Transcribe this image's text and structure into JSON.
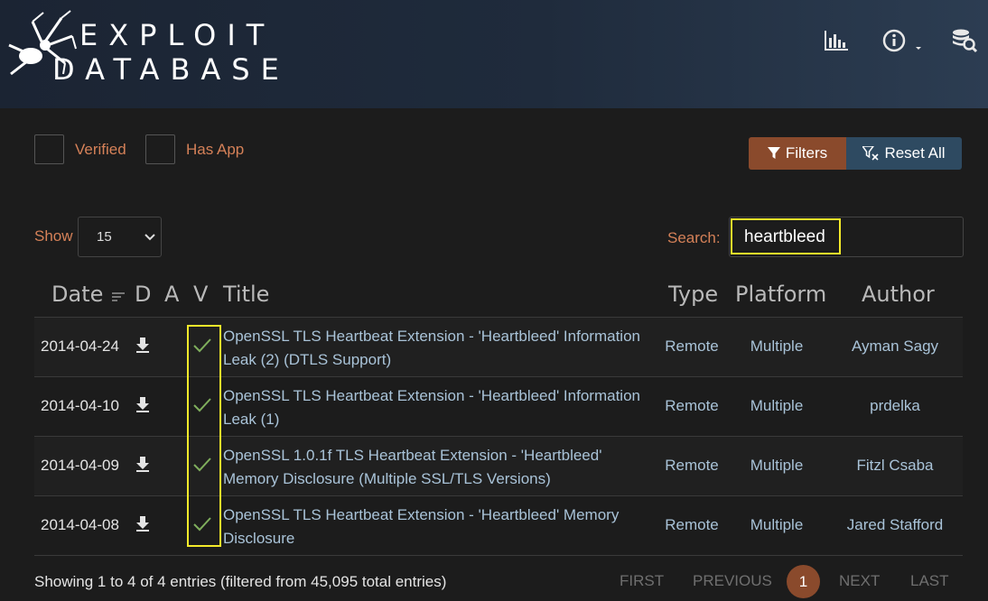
{
  "header": {
    "logo_line1": "EXPLOIT",
    "logo_line2": "DATABASE",
    "icons": [
      "stats-icon",
      "info-icon",
      "search-database-icon"
    ]
  },
  "filters": {
    "verified_label": "Verified",
    "has_app_label": "Has App",
    "filters_button": "Filters",
    "reset_button": "Reset All"
  },
  "controls": {
    "show_label": "Show",
    "show_value": "15",
    "search_label": "Search:",
    "search_value": "heartbleed"
  },
  "table": {
    "headers": {
      "date": "Date",
      "d": "D",
      "a": "A",
      "v": "V",
      "title": "Title",
      "type": "Type",
      "platform": "Platform",
      "author": "Author"
    },
    "rows": [
      {
        "date": "2014-04-24",
        "title_line1": "OpenSSL TLS Heartbeat Extension - 'Heartbleed' Information",
        "title_line2": "Leak (2) (DTLS Support)",
        "type": "Remote",
        "platform": "Multiple",
        "author": "Ayman Sagy",
        "verified": true
      },
      {
        "date": "2014-04-10",
        "title_line1": "OpenSSL TLS Heartbeat Extension - 'Heartbleed' Information",
        "title_line2": "Leak (1)",
        "type": "Remote",
        "platform": "Multiple",
        "author": "prdelka",
        "verified": true
      },
      {
        "date": "2014-04-09",
        "title_line1": "OpenSSL 1.0.1f TLS Heartbeat Extension - 'Heartbleed'",
        "title_line2": "Memory Disclosure (Multiple SSL/TLS Versions)",
        "type": "Remote",
        "platform": "Multiple",
        "author": "Fitzl Csaba",
        "verified": true
      },
      {
        "date": "2014-04-08",
        "title_line1": "OpenSSL TLS Heartbeat Extension - 'Heartbleed' Memory",
        "title_line2": "Disclosure",
        "type": "Remote",
        "platform": "Multiple",
        "author": "Jared Stafford",
        "verified": true
      }
    ]
  },
  "footer": {
    "info": "Showing 1 to 4 of 4 entries (filtered from 45,095 total entries)",
    "first": "FIRST",
    "previous": "PREVIOUS",
    "current_page": "1",
    "next": "NEXT",
    "last": "LAST"
  },
  "colors": {
    "accent": "#8a4a2c",
    "label_orange": "#d58158",
    "link_blue": "#a9c3d8",
    "highlight_yellow": "#f4ea2a"
  }
}
